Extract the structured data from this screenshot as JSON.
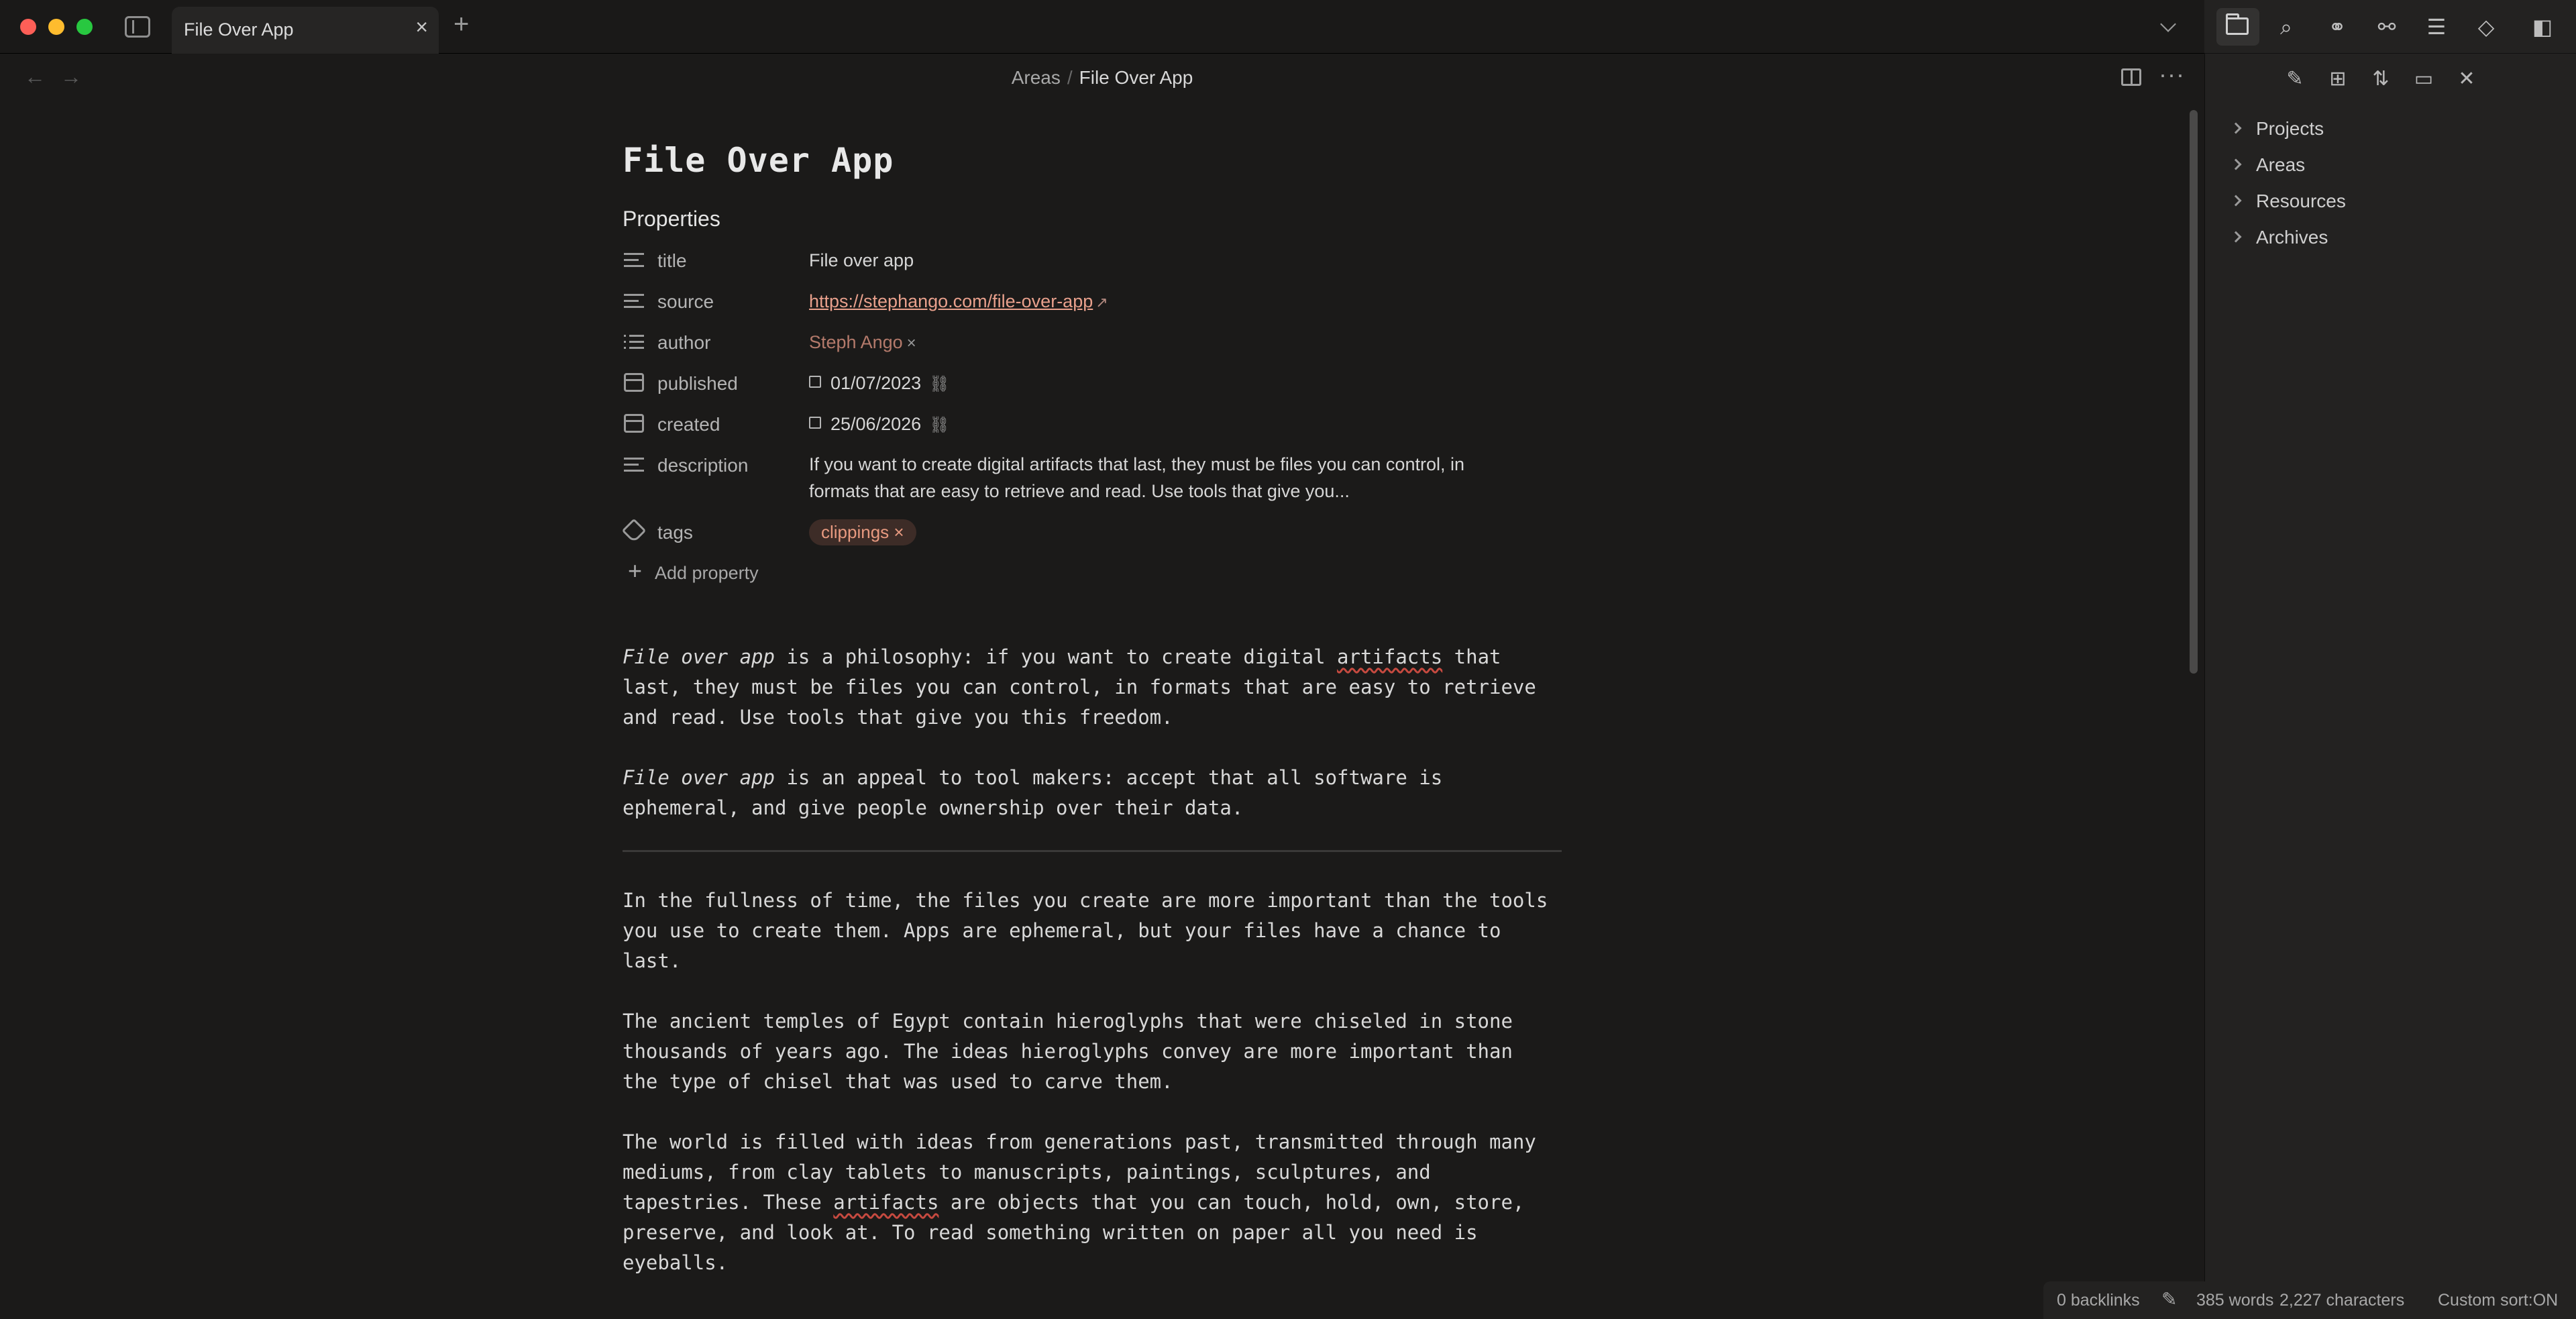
{
  "tabs": [
    {
      "title": "File Over App"
    }
  ],
  "breadcrumb": {
    "parent": "Areas",
    "separator": "/",
    "current": "File Over App"
  },
  "note": {
    "title": "File Over App",
    "properties_heading": "Properties",
    "properties": [
      {
        "key": "title",
        "value": "File over app",
        "icon": "text-lines-icon"
      },
      {
        "key": "source",
        "value": "https://stephango.com/file-over-app",
        "icon": "text-lines-icon"
      },
      {
        "key": "author",
        "value": "Steph Ango",
        "icon": "list-icon"
      },
      {
        "key": "published",
        "value": "01/07/2023",
        "icon": "calendar-icon"
      },
      {
        "key": "created",
        "value": "25/06/2026",
        "icon": "calendar-icon"
      },
      {
        "key": "description",
        "value": "If you want to create digital artifacts that last, they must be files you can control, in formats that are easy to retrieve and read. Use tools that give you...",
        "icon": "text-lines-icon"
      },
      {
        "key": "tags",
        "value": "clippings",
        "icon": "tag-icon"
      }
    ],
    "add_property_label": "Add property",
    "paragraphs": {
      "p1_em": "File over app",
      "p1_rest_a": " is a philosophy: if you want to create digital ",
      "p1_spell": "artifacts",
      "p1_rest_b": " that last, they must be files you can control, in formats that are easy to retrieve and read. Use tools that give you this freedom.",
      "p2_em": "File over app",
      "p2_rest": " is an appeal to tool makers: accept that all software is ephemeral, and give people ownership over their data.",
      "p3": "In the fullness of time, the files you create are more important than the tools you use to create them. Apps are ephemeral, but your files have a chance to last.",
      "p4": "The ancient temples of Egypt contain hieroglyphs that were chiseled in stone thousands of years ago. The ideas hieroglyphs convey are more important than the type of chisel that was used to carve them.",
      "p5_a": "The world is filled with ideas from generations past, transmitted through many mediums, from clay tablets to manuscripts, paintings, sculptures, and tapestries. These ",
      "p5_spell": "artifacts",
      "p5_b": " are objects that you can touch, hold, own, store, preserve, and look at. To read something written on paper all you need is eyeballs."
    }
  },
  "file_explorer": {
    "folders": [
      "Projects",
      "Areas",
      "Resources",
      "Archives"
    ]
  },
  "status_bar": {
    "backlinks": "0 backlinks",
    "words": "385 words",
    "characters": "2,227 characters",
    "sort": "Custom sort:ON"
  },
  "colors": {
    "accent_link": "#e8a08c",
    "tag_bg": "#3d2c27",
    "tag_fg": "#e89a80"
  }
}
